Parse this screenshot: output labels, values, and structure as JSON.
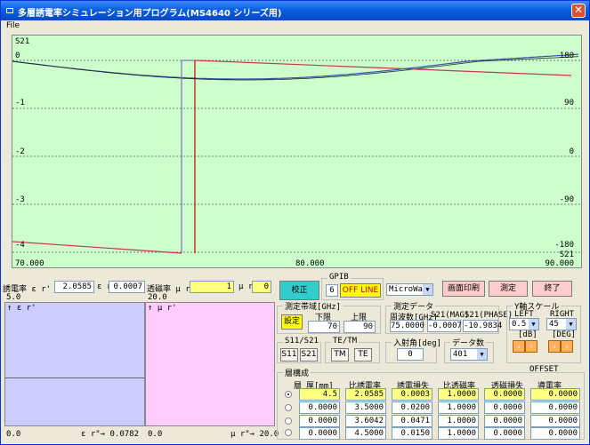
{
  "window": {
    "title": "多層誘電率シミュレーション用プログラム(MS4640 シリーズ用)",
    "menu_file": "File"
  },
  "chart": {
    "param": "S21",
    "left_ticks": [
      "0",
      "-1",
      "-2",
      "-3",
      "-4"
    ],
    "right_ticks": [
      "180",
      "90",
      "0",
      "-90",
      "-180"
    ],
    "x_left": "70.000",
    "x_mid": "80.000",
    "x_right": "90.000",
    "right_param": "S21",
    "colors": {
      "bg": "#ccffcc",
      "mag": "#cc3355",
      "phase": "#3355aa",
      "marker_lo": "#8866cc",
      "marker_hi": "#cc0000"
    }
  },
  "params": {
    "er_label": "誘電率 ε r'",
    "er_value": "2.0585",
    "er2_label": "ε r\"",
    "er2_value": "0.0007",
    "mur_label": "透磁率 μ r'",
    "mur_value": "1",
    "mur2_label": "μ r\"",
    "mur2_value": "0"
  },
  "plots": {
    "left_top_scale": "5.0",
    "left_axis": "↑ ε r'",
    "left_bottom": "0.0",
    "left_bottom_right": "ε r\"→ 0.0782",
    "right_top_scale": "20.0",
    "right_axis": "↑ μ r'",
    "right_bottom": "0.0",
    "right_bottom_right": "μ r\"→ 20.0"
  },
  "controls": {
    "calib": "校正",
    "gpib_group": "GPIB",
    "gpib_addr": "6",
    "gpib_state": "OFF LINE",
    "model_select": "MicroWave",
    "print_button": "画面印刷",
    "measure_button": "測定",
    "exit_button": "終了",
    "band_group": "測定帯域[GHz]",
    "set_button": "設定",
    "lower_label": "下限",
    "upper_label": "上限",
    "lower_value": "70",
    "upper_value": "90",
    "meas_group": "測定データ",
    "freq_hdr": "周波数[GHz]",
    "mag_hdr": "S21(MAG)",
    "phase_hdr": "S21(PHASE)",
    "freq_val": "75.0000",
    "mag_val": "-0.0007",
    "phase_val": "-10.9834",
    "yscale_group": "Y軸スケール",
    "left_label": "LEFT",
    "right_label": "RIGHT",
    "left_select": "0.5",
    "right_select": "45",
    "left_unit": "[dB]",
    "right_unit": "[DEG]",
    "offset_label": "OFFSET",
    "s_group": "S11/S21",
    "s11": "S11",
    "s21": "S21",
    "tetm_group": "TE/TM",
    "tm": "TM",
    "te": "TE",
    "angle_group": "入射角[deg]",
    "angle_val": "0",
    "points_group": "データ数",
    "points_val": "401"
  },
  "layers": {
    "group": "層構成",
    "headers": [
      "層",
      "厚[mm]",
      "比誘電率",
      "誘電損失",
      "比透磁率",
      "透磁損失",
      "導電率"
    ],
    "rows": [
      [
        "4.5",
        "2.0585",
        "0.0003",
        "1.0000",
        "0.0000",
        "0.0000"
      ],
      [
        "0.0000",
        "3.5000",
        "0.0200",
        "1.0000",
        "0.0000",
        "0.0000"
      ],
      [
        "0.0000",
        "3.6042",
        "0.0471",
        "1.0000",
        "0.0000",
        "0.0000"
      ],
      [
        "0.0000",
        "4.5000",
        "0.0150",
        "1.0000",
        "0.0000",
        "0.0000"
      ]
    ],
    "selected": 0
  }
}
